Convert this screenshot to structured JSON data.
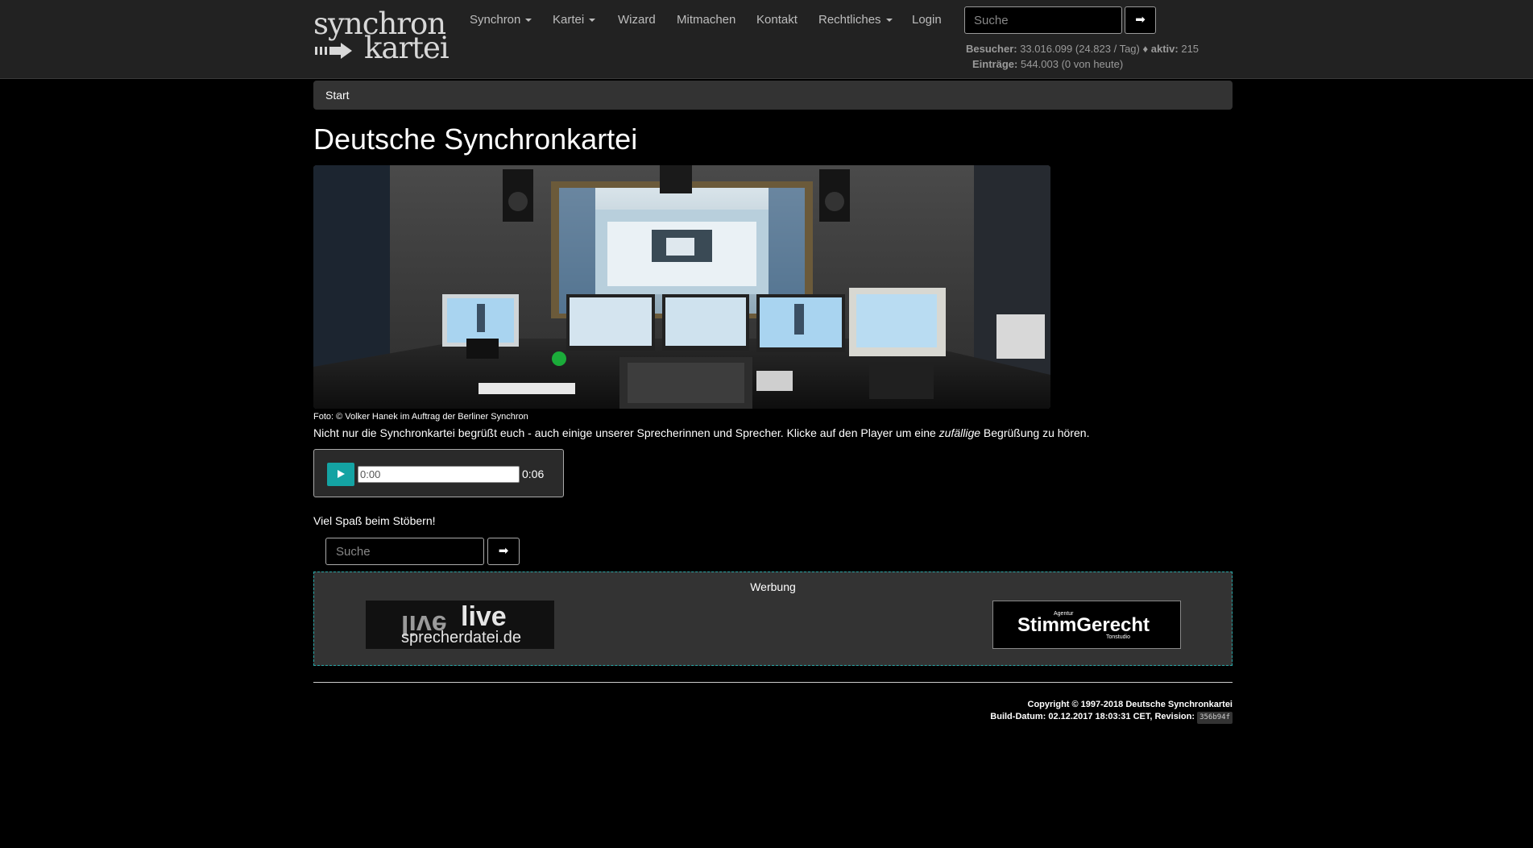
{
  "brand": {
    "line1": "synchron",
    "line2": "kartei"
  },
  "nav": {
    "items": [
      {
        "label": "Synchron",
        "dropdown": true
      },
      {
        "label": "Kartei",
        "dropdown": true
      },
      {
        "label": "Wizard",
        "dropdown": false
      },
      {
        "label": "Mitmachen",
        "dropdown": false
      },
      {
        "label": "Kontakt",
        "dropdown": false
      },
      {
        "label": "Rechtliches",
        "dropdown": true
      },
      {
        "label": "Login",
        "dropdown": false
      }
    ],
    "search_placeholder": "Suche",
    "search_button": "➡"
  },
  "stats": {
    "visitors_label": "Besucher:",
    "visitors_value": "33.016.099 (24.823 / Tag)",
    "separator": "♦",
    "active_label": "aktiv:",
    "active_value": "215",
    "entries_label": "Einträge:",
    "entries_value": "544.003 (0 von heute)"
  },
  "breadcrumb": {
    "current": "Start"
  },
  "page": {
    "title": "Deutsche Synchronkartei",
    "photo_credit": "Foto: © Volker Hanek im Auftrag der Berliner Synchron",
    "intro_before": "Nicht nur die Synchronkartei begrüßt euch - auch einige unserer Sprecherinnen und Sprecher. Klicke auf den Player um eine ",
    "intro_em": "zufällige",
    "intro_after": " Begrüßung zu hören.",
    "enjoy": "Viel Spaß beim Stöbern!"
  },
  "player": {
    "current_time": "0:00",
    "duration": "0:06",
    "progress": 0
  },
  "search": {
    "placeholder": "Suche",
    "button": "➡"
  },
  "ads": {
    "title": "Werbung",
    "ad1_text_top": "live",
    "ad1_text_bottom": "sprecherdatei.de",
    "ad2_small_top": "Agentur",
    "ad2_text": "StimmGerecht",
    "ad2_small_bottom": "Tonstudio"
  },
  "footer": {
    "copyright": "Copyright © 1997-2018 Deutsche Synchronkartei",
    "build_prefix": "Build-Datum: 02.12.2017 18:03:31 CET, Revision:",
    "revision": "356b94f"
  },
  "colors": {
    "accent": "#14a3a3",
    "navbar": "#222222",
    "panel": "#333333"
  }
}
